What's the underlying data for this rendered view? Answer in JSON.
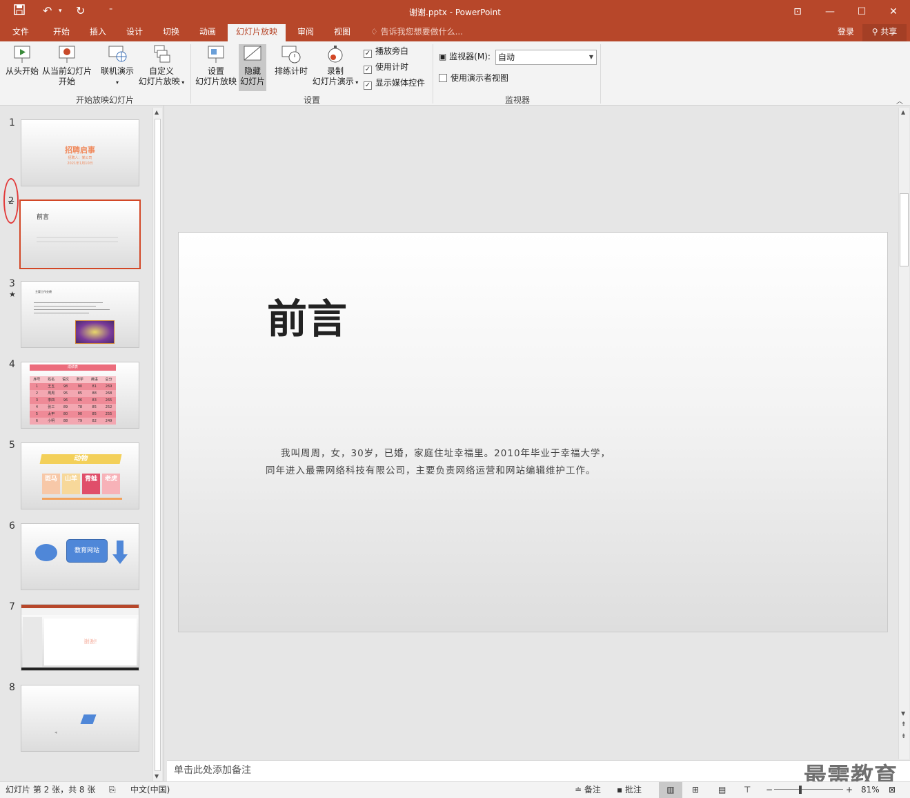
{
  "window": {
    "title": "谢谢.pptx - PowerPoint",
    "controls": [
      "⊡",
      "—",
      "☐",
      "✕"
    ]
  },
  "qat": {
    "save_icon": "save-icon",
    "undo_icon": "undo-icon",
    "redo_icon": "redo-icon",
    "customize_icon": "customize-icon"
  },
  "menu": {
    "tabs": [
      "文件",
      "开始",
      "插入",
      "设计",
      "切换",
      "动画",
      "幻灯片放映",
      "审阅",
      "视图"
    ],
    "active": "幻灯片放映",
    "tellme": "告诉我您想要做什么...",
    "login": "登录",
    "share": "共享"
  },
  "ribbon": {
    "from_start": "从头开始",
    "from_current": [
      "从当前幻灯片",
      "开始"
    ],
    "online": "联机演示",
    "custom": [
      "自定义",
      "幻灯片放映"
    ],
    "group1": "开始放映幻灯片",
    "setup": [
      "设置",
      "幻灯片放映"
    ],
    "hide": [
      "隐藏",
      "幻灯片"
    ],
    "rehearse": "排练计时",
    "record": [
      "录制",
      "幻灯片演示"
    ],
    "chk_narration": "播放旁白",
    "chk_timings": "使用计时",
    "chk_media": "显示媒体控件",
    "group2": "设置",
    "monitor_label": "监视器(M):",
    "monitor_value": "自动",
    "presenter_view": "使用演示者视图",
    "group3": "监视器"
  },
  "thumbs": {
    "numbers": [
      "1",
      "2",
      "3",
      "4",
      "5",
      "6",
      "7",
      "8"
    ],
    "s1": {
      "title": "招聘启事",
      "sub1": "招聘人：某公司",
      "sub2": "2021年1月10日"
    },
    "s2": {
      "title": "前言"
    },
    "s3": {
      "title": "主要工作业绩"
    },
    "s4": {
      "title": "成绩表",
      "headers": [
        "序号",
        "姓名",
        "语文",
        "数学",
        "英语",
        "总分"
      ],
      "rows": [
        [
          "1",
          "王五",
          "98",
          "90",
          "81",
          "269"
        ],
        [
          "2",
          "周周",
          "95",
          "85",
          "88",
          "268"
        ],
        [
          "3",
          "李四",
          "96",
          "86",
          "83",
          "265"
        ],
        [
          "4",
          "张三",
          "89",
          "78",
          "85",
          "252"
        ],
        [
          "5",
          "太甲",
          "80",
          "90",
          "85",
          "255"
        ],
        [
          "6",
          "小明",
          "88",
          "79",
          "82",
          "249"
        ]
      ]
    },
    "s5": {
      "title": "动物",
      "cards": [
        "斑马",
        "山羊",
        "青蛙",
        "老虎"
      ]
    },
    "s6": {
      "label": "教育网站"
    },
    "s7": {
      "label": "谢谢!"
    }
  },
  "slide": {
    "title": "前言",
    "body_line1": "我叫周周，女，30岁，已婚，家庭住址幸福里。2010年毕业于幸福大学，",
    "body_line2": "同年进入最需网络科技有限公司，主要负责网络运营和网站编辑维护工作。"
  },
  "notes": {
    "placeholder": "单击此处添加备注"
  },
  "watermark": "最需教育",
  "status": {
    "slide_info": "幻灯片 第 2 张，共 8 张",
    "lang": "中文(中国)",
    "notes_btn": "备注",
    "comments_btn": "批注",
    "zoom": "81%"
  },
  "colors": {
    "accent": "#b7472a",
    "selection": "#d24726"
  }
}
